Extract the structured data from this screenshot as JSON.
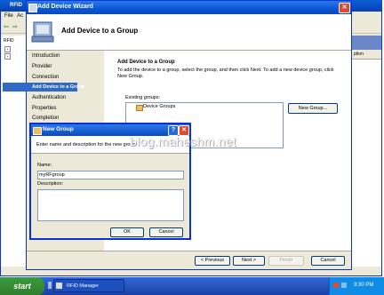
{
  "background_app": {
    "title": "RFID",
    "menu": [
      "File",
      "Ac"
    ],
    "tree_item": "RFID",
    "column_header": "ption"
  },
  "wizard": {
    "title": "Add Device Wizard",
    "header_title": "Add Device to a Group",
    "steps": [
      "Introduction",
      "Provider",
      "Connection",
      "Add Device to a Group",
      "Authentication",
      "Properties",
      "Completion"
    ],
    "content_title": "Add Device to a Group",
    "content_desc": "To add the device to a group, select the group, and then click Next. To add a new device group, click New Group.",
    "existing_groups_label": "Existing groups:",
    "groups": [
      "Device Groups"
    ],
    "new_group_button": "New Group...",
    "previous_button": "< Previous",
    "next_button": "Next >",
    "finish_button": "Finish",
    "cancel_button": "Cancel"
  },
  "dialog": {
    "title": "New Group",
    "prompt": "Enter name and description for the new group",
    "name_label": "Name:",
    "name_value": "myRFgroup",
    "description_label": "Description:",
    "description_value": "",
    "ok_button": "OK",
    "cancel_button": "Cancel",
    "help_glyph": "?",
    "close_glyph": "✕"
  },
  "watermark": "blog.maheshm.net",
  "taskbar": {
    "start_label": "start",
    "task_label": "RFID Manager",
    "clock": "9:30 PM"
  },
  "colors": {
    "title_blue": "#0a56d4",
    "selection_blue": "#316ac5",
    "taskbar_blue": "#1941a5",
    "start_green": "#3c9b3c"
  }
}
